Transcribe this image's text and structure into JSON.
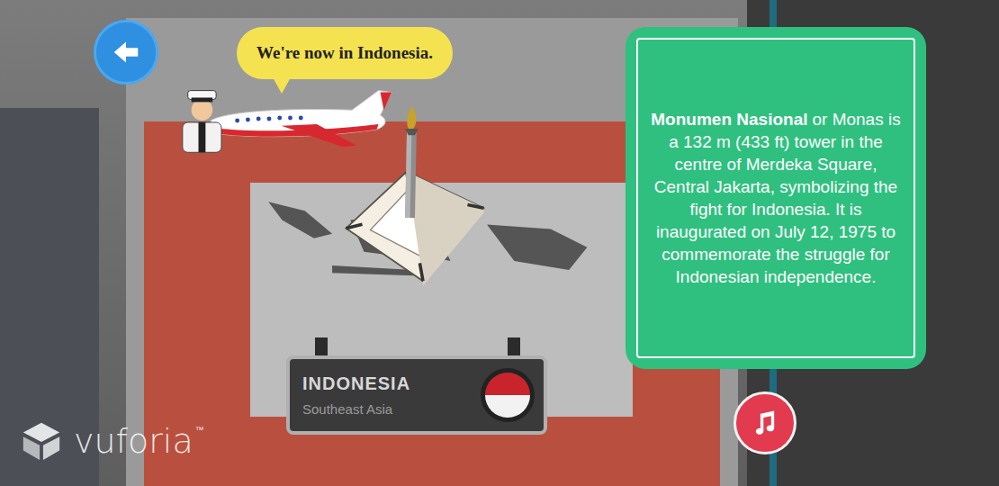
{
  "speech_bubble": {
    "text": "We're now in Indonesia."
  },
  "info_panel": {
    "title": "Monumen Nasional",
    "body": "or Monas is a 132 m (433 ft) tower in the centre of Merdeka Square, Central Jakarta, symbolizing the fight for Indonesia. It is inaugurated on July 12, 1975 to commemorate the struggle for  Indonesian independence."
  },
  "sign": {
    "country": "INDONESIA",
    "region": "Southeast Asia"
  },
  "watermark": {
    "brand": "vuforia",
    "mark": "™"
  }
}
